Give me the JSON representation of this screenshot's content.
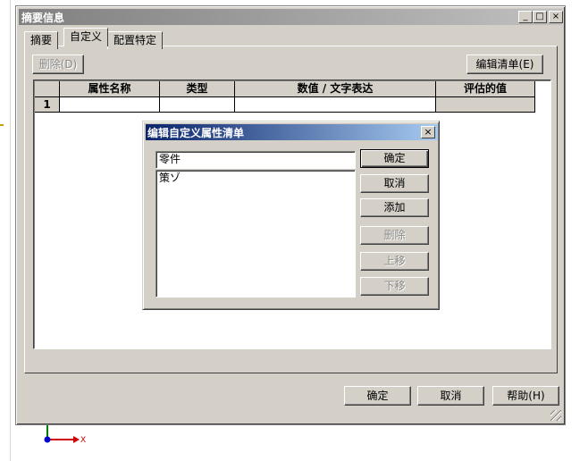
{
  "window": {
    "title": "摘要信息",
    "minimize_glyph": "_",
    "maximize_glyph": "□",
    "close_glyph": "×"
  },
  "tabs": [
    {
      "label": "摘要"
    },
    {
      "label": "自定义"
    },
    {
      "label": "配置特定"
    }
  ],
  "toolbar": {
    "delete_label": "删除(D)",
    "edit_list_label": "编辑清单(E)"
  },
  "grid": {
    "headers": [
      "属性名称",
      "类型",
      "数值 / 文字表达",
      "评估的值"
    ],
    "rows": [
      {
        "index": "1",
        "cells": [
          "",
          "",
          "",
          ""
        ]
      }
    ]
  },
  "dialog": {
    "title": "编辑自定义属性清单",
    "close_glyph": "×",
    "input_value": "零件",
    "list_items": [
      "策ゾ"
    ],
    "buttons": {
      "ok": "确定",
      "cancel": "取消",
      "add": "添加",
      "delete": "删除",
      "move_up": "上移",
      "move_down": "下移"
    }
  },
  "footer": {
    "ok": "确定",
    "cancel": "取消",
    "help": "帮助(H)"
  },
  "triad": {
    "x_label": "X"
  }
}
